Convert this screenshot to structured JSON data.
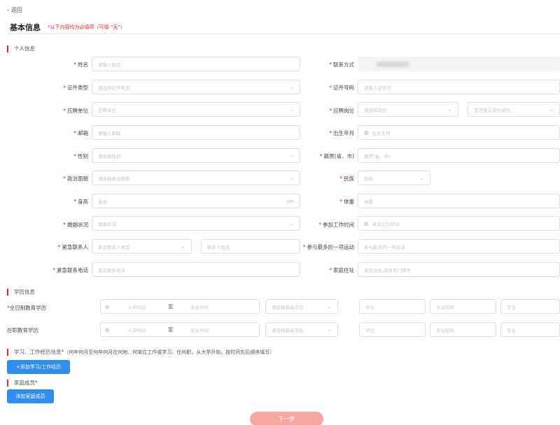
{
  "header": {
    "back_label": "返回",
    "title": "基本信息",
    "required_note": "*以下内容均为必填项（可填 “无”）"
  },
  "sections": {
    "personal": "个人信息",
    "education": "学历信息",
    "experience": "学习、工作经历信息*",
    "experience_note": "（何年何月至何年何月在何地、何单位工作或学习、任何职，从大学开始，按时间先后顺序填写）",
    "family": "家庭成员*"
  },
  "personal": {
    "name": {
      "label": "姓名",
      "placeholder": "请输入姓名"
    },
    "contact": {
      "label": "联系方式"
    },
    "id_type": {
      "label": "证件类型",
      "placeholder": "请选择证件类型"
    },
    "id_number": {
      "label": "证件号码",
      "placeholder": "请输入证件号"
    },
    "unit": {
      "label": "应聘单位",
      "placeholder": "应聘单位"
    },
    "position": {
      "label": "应聘岗位",
      "placeholder": "请选择岗位",
      "placeholder2": "是否服从岗位调剂"
    },
    "email": {
      "label": "邮箱",
      "placeholder": "请输入邮箱"
    },
    "birth": {
      "label": "出生年月",
      "placeholder": "出生年月"
    },
    "gender": {
      "label": "性别",
      "placeholder": "请选择性别"
    },
    "origin": {
      "label": "籍贯(省、市)",
      "placeholder": "籍贯(省、市)"
    },
    "political": {
      "label": "政治面貌",
      "placeholder": "请选择政治面貌"
    },
    "ethnicity": {
      "label": "民族",
      "placeholder": "民族"
    },
    "height": {
      "label": "身高",
      "placeholder": "身高",
      "unit": "cm"
    },
    "weight": {
      "label": "体重",
      "placeholder": "体重"
    },
    "marital": {
      "label": "婚姻状况",
      "placeholder": "婚姻状况"
    },
    "work_start": {
      "label": "参加工作时间",
      "placeholder": "参加工作时间"
    },
    "emergency_contact": {
      "label": "紧急联系人",
      "placeholder": "紧急联系人类型",
      "placeholder2": "联系人姓名"
    },
    "sport": {
      "label": "参与最多的一项运动",
      "placeholder": "参与最多的一项运动"
    },
    "emergency_phone": {
      "label": "紧急联系电话",
      "placeholder": "紧急联系电话"
    },
    "address": {
      "label": "家庭住址",
      "placeholder": "家庭住址,具体到门牌号"
    }
  },
  "education": {
    "fulltime": {
      "label": "全日制教育学历",
      "start": "入学时间",
      "to": "至",
      "end": "毕业时间",
      "degree": "请选择最高学历",
      "field3": "学位",
      "school": "毕业院校",
      "major": "专业"
    },
    "inservice": {
      "label": "在职教育学历",
      "start": "入学时间",
      "to": "至",
      "end": "毕业时间",
      "degree": "请选择最高学历",
      "field3": "学位",
      "school": "毕业院校",
      "major": "专业"
    }
  },
  "buttons": {
    "add_experience": "+添加学习/工作经历",
    "add_family": "添加家庭成员",
    "next": "下一步"
  },
  "colors": {
    "required": "#f5222d",
    "primary": "#2f8ef0",
    "next_button": "#f7a6a2"
  }
}
